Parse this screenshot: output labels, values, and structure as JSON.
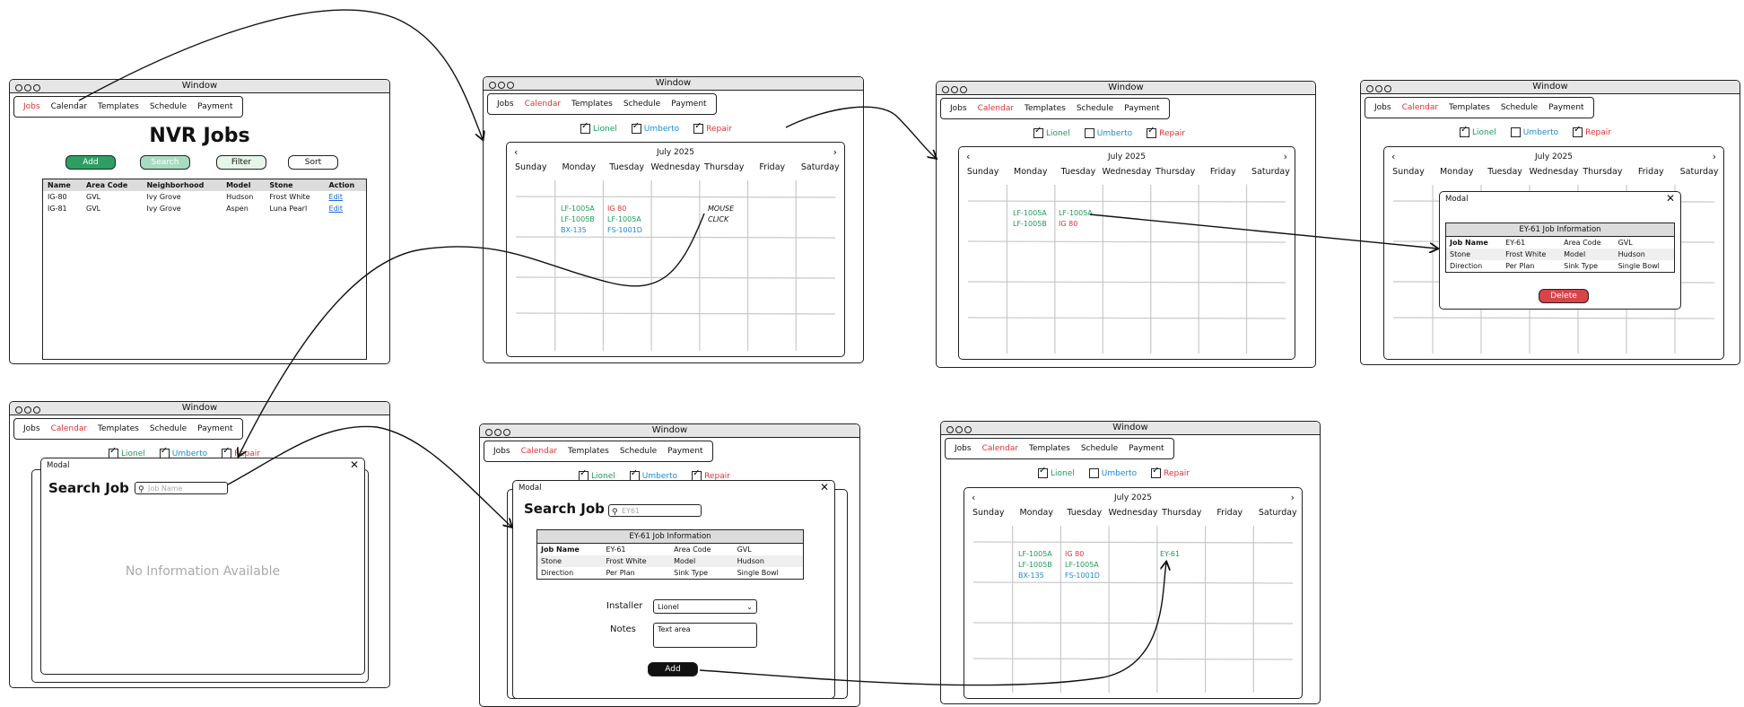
{
  "window_title": "Window",
  "nav": [
    "Jobs",
    "Calendar",
    "Templates",
    "Schedule",
    "Payment"
  ],
  "jobs_screen": {
    "title": "NVR Jobs",
    "buttons": {
      "add": "Add",
      "search": "Search",
      "filter": "Filter",
      "sort": "Sort"
    },
    "columns": [
      "Name",
      "Area Code",
      "Neighborhood",
      "Model",
      "Stone",
      "Action"
    ],
    "rows": [
      [
        "IG-80",
        "GVL",
        "Ivy Grove",
        "Hudson",
        "Frost White",
        "Edit"
      ],
      [
        "IG-81",
        "GVL",
        "Ivy Grove",
        "Aspen",
        "Luna Pearl",
        "Edit"
      ]
    ]
  },
  "filters": {
    "lionel": "Lionel",
    "umberto": "Umberto",
    "repair": "Repair"
  },
  "calendar": {
    "month": "July 2025",
    "prev": "‹",
    "next": "›",
    "days": [
      "Sunday",
      "Monday",
      "Tuesday",
      "Wednesday",
      "Thursday",
      "Friday",
      "Saturday"
    ]
  },
  "events": {
    "lf1005a": "LF-1005A",
    "lf1005b": "LF-1005B",
    "bx135": "BX-135",
    "ig80": "IG 80",
    "fs1001d": "FS-1001D",
    "ey61": "EY-61"
  },
  "mouse_click": "MOUSE CLICK",
  "modal": {
    "title": "Modal",
    "close": "✕",
    "search_title": "Search Job",
    "search_placeholder": "Job Name",
    "search_value": "EY61",
    "no_info": "No Information Available",
    "info_title": "EY-61 Job Information",
    "info": {
      "job_name_label": "Job Name",
      "job_name": "EY-61",
      "area_code_label": "Area Code",
      "area_code": "GVL",
      "stone_label": "Stone",
      "stone": "Frost White",
      "model_label": "Model",
      "model": "Hudson",
      "direction_label": "Direction",
      "direction": "Per Plan",
      "sink_label": "Sink Type",
      "sink": "Single Bowl"
    },
    "installer_label": "Installer",
    "installer_value": "Lionel",
    "notes_label": "Notes",
    "notes_value": "Text area",
    "add": "Add",
    "delete": "Delete"
  },
  "colors": {
    "green": "#1e9a5a",
    "blue": "#1a8ad6",
    "red": "#d33333",
    "add_btn": "#2e9e63",
    "search_btn": "#a8dcc0",
    "filter_btn": "#e4f5ea",
    "delete_btn": "#d9434a"
  }
}
